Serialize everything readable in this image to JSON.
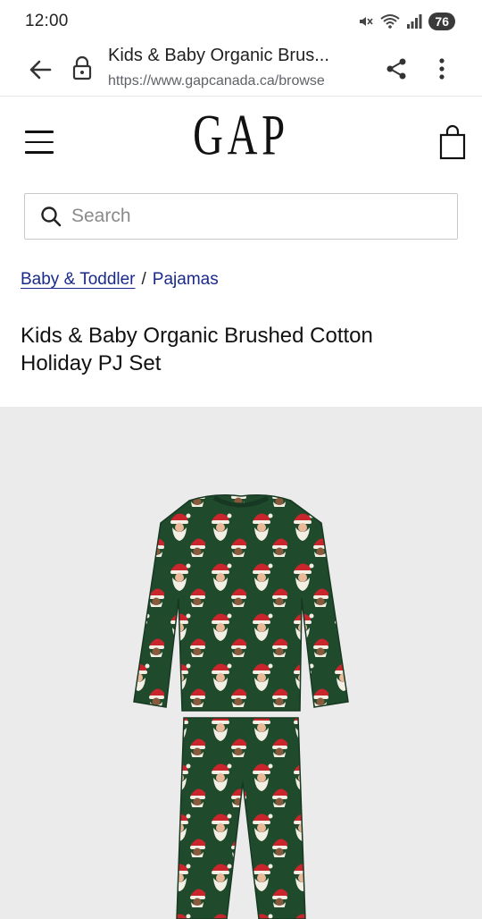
{
  "status_bar": {
    "time": "12:00",
    "battery": "76",
    "icons": [
      "mute-icon",
      "wifi-icon",
      "signal-icon",
      "battery-icon"
    ]
  },
  "browser": {
    "page_title": "Kids & Baby Organic Brus...",
    "url": "https://www.gapcanada.ca/browse",
    "icons": [
      "back-arrow-icon",
      "lock-icon",
      "share-icon",
      "more-vert-icon"
    ]
  },
  "site": {
    "logo": "GAP",
    "icons": [
      "hamburger-menu-icon",
      "shopping-bag-icon"
    ]
  },
  "search": {
    "placeholder": "Search",
    "value": ""
  },
  "breadcrumb": {
    "category": "Baby & Toddler",
    "separator": "/",
    "subcategory": "Pajamas"
  },
  "product": {
    "title": "Kids & Baby Organic Brushed Cotton Holiday PJ Set"
  },
  "colors": {
    "link": "#1a2a8a",
    "pajama_green": "#1f4a2c",
    "santa_red": "#c8262c",
    "image_bg": "#ebebeb"
  }
}
